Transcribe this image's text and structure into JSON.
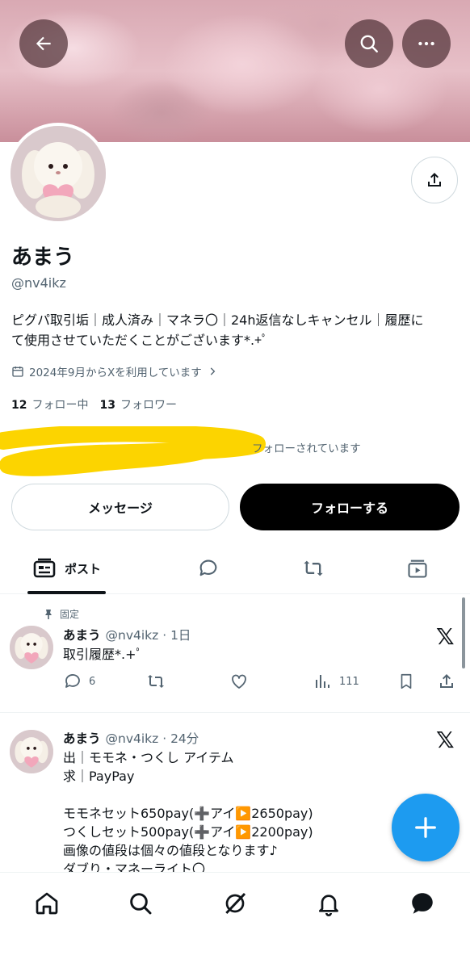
{
  "header": {
    "back_icon": "arrow-left-icon",
    "search_icon": "search-icon",
    "more_icon": "more-horizontal-icon"
  },
  "profile": {
    "name": "あまう",
    "handle": "@nv4ikz",
    "bio_line1": "ピグパ取引垢｜成人済み｜マネラ〇｜24h返信なしキャンセル｜履歴に",
    "bio_line2": "て使用させていただくことがございます*.+ﾟ",
    "joined": "2024年9月からXを利用しています",
    "following_count": "12",
    "following_label": "フォロー中",
    "followers_count": "13",
    "followers_label": "フォロワー",
    "followed_by": "フォローされています"
  },
  "buttons": {
    "message": "メッセージ",
    "follow": "フォローする"
  },
  "tabs": [
    {
      "label": "ポスト",
      "icon": "posts-icon",
      "active": true
    },
    {
      "label": "",
      "icon": "replies-icon"
    },
    {
      "label": "",
      "icon": "reposts-icon"
    },
    {
      "label": "",
      "icon": "media-icon"
    }
  ],
  "posts": [
    {
      "pinned_label": "固定",
      "name": "あまう",
      "handle_time": "@nv4ikz · 1日",
      "text": "取引履歴*.+ﾟ",
      "replies": "6",
      "views": "111"
    },
    {
      "name": "あまう",
      "handle_time": "@nv4ikz · 24分",
      "text": "出｜モモネ・つくし アイテム\n求｜PayPay\n\nモモネセット650pay(➕アイ▶️2650pay)\nつくしセット500pay(➕アイ▶️2200pay)\n画像の値段は個々の値段となります♪\nダブり・マネーライト〇"
    }
  ],
  "x_logo": "𝕏",
  "colors": {
    "accent": "#1d9bf0",
    "text": "#0f1419",
    "muted": "#536471",
    "highlight_scribble": "#fcd400"
  },
  "bottom_nav": [
    "home-icon",
    "search-icon",
    "grok-icon",
    "notifications-icon",
    "messages-icon"
  ]
}
